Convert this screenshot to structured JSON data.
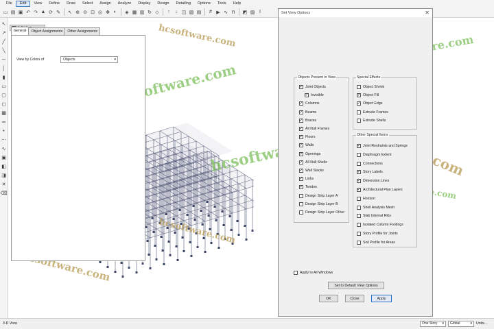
{
  "menu": [
    "File",
    "Edit",
    "View",
    "Define",
    "Draw",
    "Select",
    "Assign",
    "Analyze",
    "Display",
    "Design",
    "Detailing",
    "Options",
    "Tools",
    "Help"
  ],
  "active_menu_index": 1,
  "toolbar_icons": [
    "new-file-icon",
    "open-folder-icon",
    "save-icon",
    "undo-icon",
    "redo-icon",
    "lock-icon",
    "refresh-icon",
    "pencil-icon",
    "pointer-icon",
    "zoom-in-icon",
    "zoom-out-icon",
    "zoom-window-icon",
    "zoom-fit-icon",
    "pan-icon",
    "zoom-previous-icon",
    "3d-view-icon",
    "plan-view-icon",
    "elevation-view-icon",
    "rotate-icon",
    "perspective-icon",
    "up-arrow-icon",
    "down-arrow-icon",
    "object-shrink-icon",
    "set-display-icon",
    "show-tables-icon",
    "grid-icon",
    "run-analysis-icon",
    "deformed-shape-icon",
    "force-diagram-icon",
    "design-icon",
    "concrete-icon",
    "steel-icon"
  ],
  "left_tools": [
    "pointer-icon",
    "reshape-icon",
    "draw-frame-icon",
    "draw-brace-icon",
    "draw-beam-icon",
    "draw-column-icon",
    "draw-wall-icon",
    "draw-floor-icon",
    "draw-opening-icon",
    "draw-area-icon",
    "draw-slab-icon",
    "draw-strip-icon",
    "draw-point-icon",
    "draw-link-icon",
    "draw-tendon-icon",
    "select-all-icon",
    "select-previous-icon",
    "deselect-icon",
    "intersecting-line-icon",
    "clear-selection-icon"
  ],
  "view_tab": "3-D View",
  "watermarks": [
    "hcsoftware.com",
    "hcsoftware.com",
    "hcsoftware.com",
    "hcsoftware.com",
    "hcsoftware.com",
    "hcsoftware.com",
    "hcsoftware.com",
    "hcsoftware.com",
    "hcsoftware.com",
    "hcsoftware.com"
  ],
  "dialog": {
    "title": "Set View Options",
    "close": "✕",
    "tabs": [
      "General",
      "Object Assignments",
      "Other Assignments"
    ],
    "view_by_color_label": "View by Colors of",
    "view_by_color_value": "Objects",
    "objects_group_title": "Objects Present in View",
    "objects": [
      {
        "label": "Joint Objects",
        "checked": true
      },
      {
        "label": "Invisible",
        "checked": true
      },
      {
        "label": "Columns",
        "checked": true
      },
      {
        "label": "Beams",
        "checked": true
      },
      {
        "label": "Braces",
        "checked": true
      },
      {
        "label": "All Null Frames",
        "checked": true
      },
      {
        "label": "Floors",
        "checked": true
      },
      {
        "label": "Walls",
        "checked": true
      },
      {
        "label": "Openings",
        "checked": true
      },
      {
        "label": "All Null Shells",
        "checked": true
      },
      {
        "label": "Wall Stacks",
        "checked": true
      },
      {
        "label": "Links",
        "checked": true
      },
      {
        "label": "Tendon",
        "checked": true
      },
      {
        "label": "Design Strip Layer A",
        "checked": false
      },
      {
        "label": "Design Strip Layer B",
        "checked": false
      },
      {
        "label": "Design Strip Layer Other",
        "checked": false
      }
    ],
    "special_group_title": "Special Effects",
    "special": [
      {
        "label": "Object Shrink",
        "checked": false
      },
      {
        "label": "Object Fill",
        "checked": true
      },
      {
        "label": "Object Edge",
        "checked": true
      },
      {
        "label": "Extrude Frames",
        "checked": false
      },
      {
        "label": "Extrude Shells",
        "checked": false
      }
    ],
    "other_group_title": "Other Special Items",
    "other": [
      {
        "label": "Joint Restraints and Springs",
        "checked": true
      },
      {
        "label": "Diaphragm Extent",
        "checked": false
      },
      {
        "label": "Connections",
        "checked": false
      },
      {
        "label": "Story Labels",
        "checked": true
      },
      {
        "label": "Dimension Lines",
        "checked": true
      },
      {
        "label": "Architectural Plan Layers",
        "checked": true
      },
      {
        "label": "Horizon",
        "checked": false
      },
      {
        "label": "Shell Analysis Mesh",
        "checked": false
      },
      {
        "label": "Slab Internal Ribs",
        "checked": false
      },
      {
        "label": "Isolated Column Footings",
        "checked": false
      },
      {
        "label": "Story Profile for Joints",
        "checked": false
      },
      {
        "label": "Soil Profile for Areas",
        "checked": false
      }
    ],
    "apply_all_label": "Apply to All Windows",
    "apply_all_checked": false,
    "default_button": "Set to Default View Options",
    "ok_button": "OK",
    "close_button": "Close",
    "apply_button": "Apply"
  },
  "status": {
    "left": "3-D View",
    "story": "One Story",
    "coord": "Global",
    "units": "Units..."
  },
  "colors": {
    "watermark_green": "#7cbf5a",
    "watermark_gold": "#b79a52",
    "model_line": "#3d4566",
    "accent": "#2a6cc9"
  }
}
